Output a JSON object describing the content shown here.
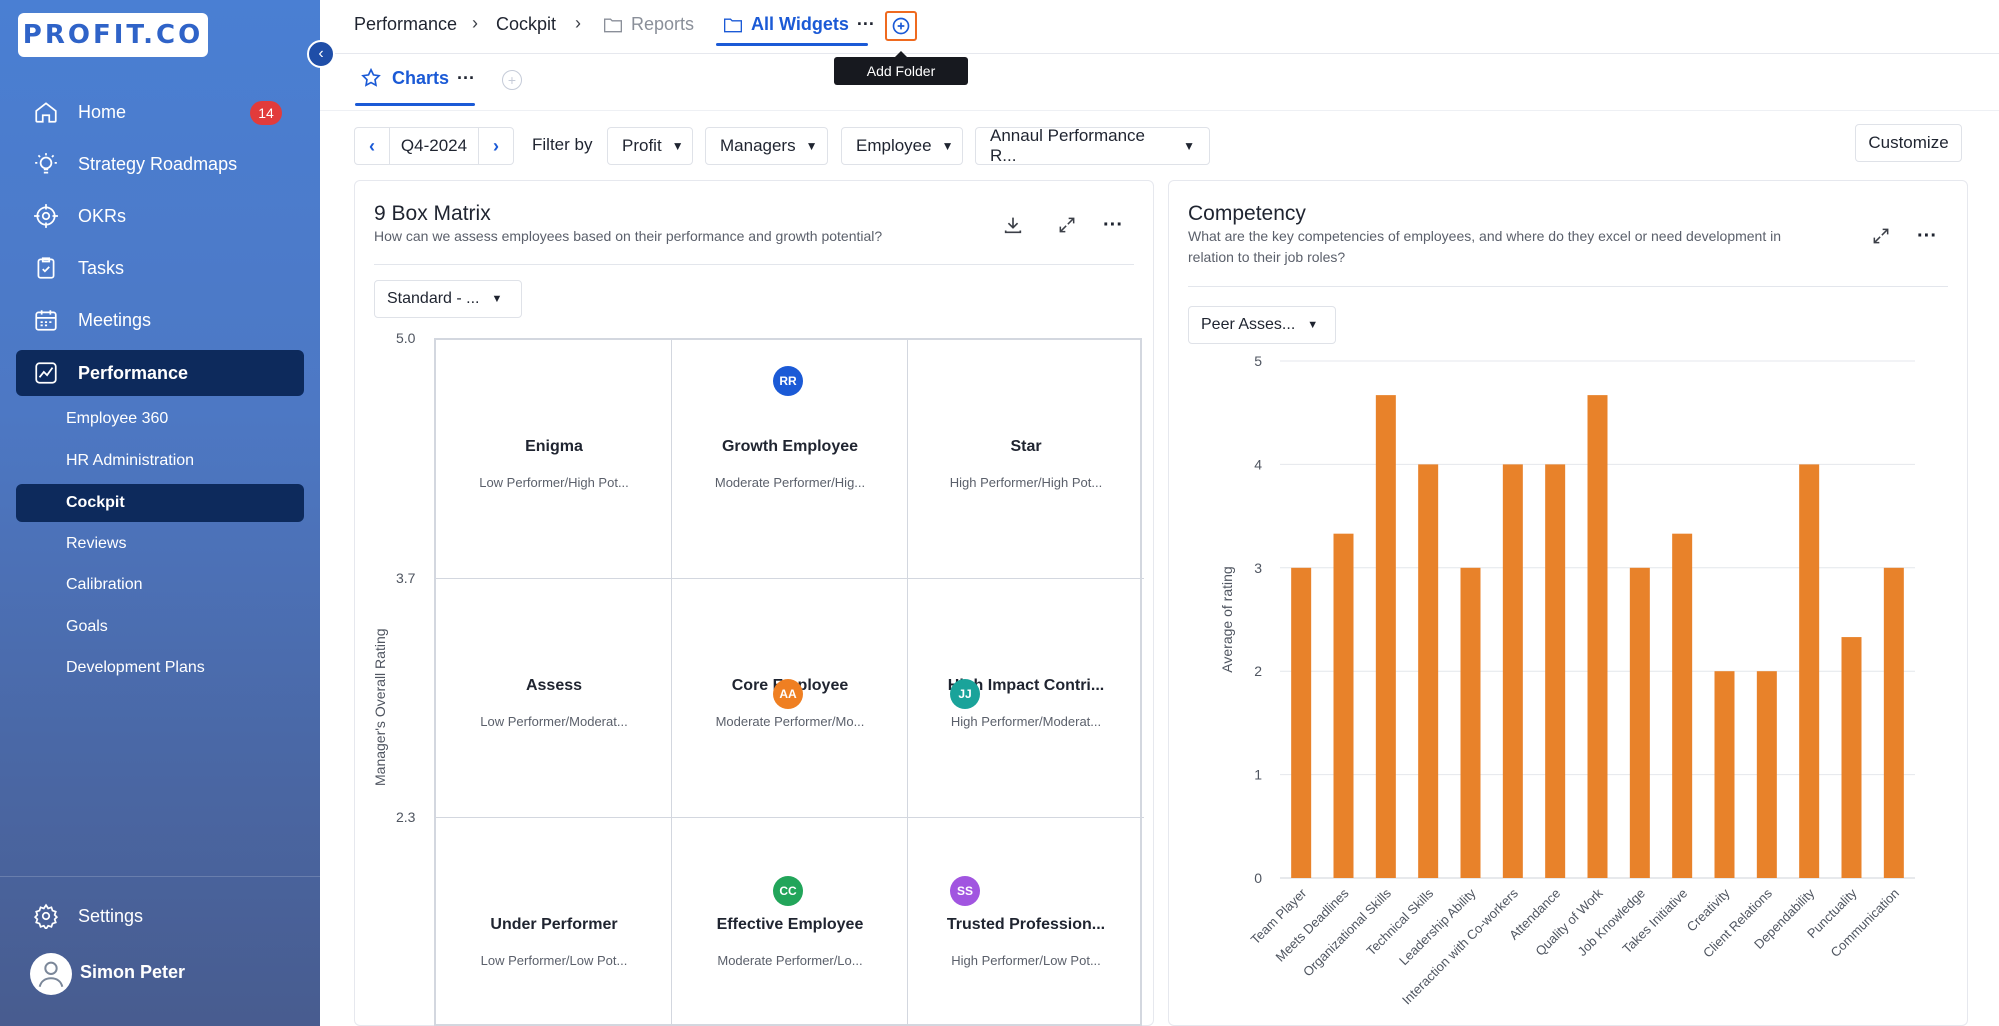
{
  "sidebar": {
    "logo": "PROFIT.CO",
    "items": [
      {
        "label": "Home",
        "badge": "14"
      },
      {
        "label": "Strategy Roadmaps"
      },
      {
        "label": "OKRs"
      },
      {
        "label": "Tasks"
      },
      {
        "label": "Meetings"
      },
      {
        "label": "Performance"
      }
    ],
    "sub_items": [
      "Employee 360",
      "HR Administration",
      "Cockpit",
      "Reviews",
      "Calibration",
      "Goals",
      "Development Plans"
    ],
    "settings": "Settings",
    "user": "Simon Peter"
  },
  "breadcrumb": {
    "items": [
      "Performance",
      "Cockpit",
      "Reports",
      "All Widgets"
    ],
    "tooltip": "Add Folder"
  },
  "tabs": {
    "charts": "Charts"
  },
  "filters": {
    "period": "Q4-2024",
    "filter_by": "Filter by",
    "profit": "Profit",
    "managers": "Managers",
    "employee": "Employee",
    "review": "Annaul Performance R...",
    "customize": "Customize"
  },
  "nine_box": {
    "title": "9 Box Matrix",
    "desc": "How can we assess employees based on their performance and growth potential?",
    "dropdown": "Standard - ...",
    "y_axis_title": "Manager's Overall Rating",
    "y_ticks": [
      "5.0",
      "3.7",
      "2.3"
    ],
    "cells": [
      {
        "title": "Enigma",
        "sub": "Low Performer/High Pot..."
      },
      {
        "title": "Growth Employee",
        "sub": "Moderate Performer/Hig..."
      },
      {
        "title": "Star",
        "sub": "High Performer/High Pot..."
      },
      {
        "title": "Assess",
        "sub": "Low Performer/Moderat..."
      },
      {
        "title": "Core Employee",
        "sub": "Moderate Performer/Mo..."
      },
      {
        "title": "High Impact Contri...",
        "sub": "High Performer/Moderat..."
      },
      {
        "title": "Under Performer",
        "sub": "Low Performer/Low Pot..."
      },
      {
        "title": "Effective Employee",
        "sub": "Moderate Performer/Lo..."
      },
      {
        "title": "Trusted Profession...",
        "sub": "High Performer/Low Pot..."
      }
    ],
    "chips": [
      {
        "initials": "RR",
        "color": "#1b5ad6"
      },
      {
        "initials": "AA",
        "color": "#ef7f22"
      },
      {
        "initials": "JJ",
        "color": "#1aa39a"
      },
      {
        "initials": "CC",
        "color": "#22a55a"
      },
      {
        "initials": "SS",
        "color": "#a155e0"
      }
    ]
  },
  "competency": {
    "title": "Competency",
    "desc_line1": "What are the key competencies of employees, and where do they excel or need development in",
    "desc_line2": "relation to their job roles?",
    "dropdown": "Peer Asses..."
  },
  "chart_data": {
    "type": "bar",
    "title": "",
    "ylabel": "Average of rating",
    "xlabel": "",
    "ylim": [
      0,
      5
    ],
    "yticks": [
      0,
      1,
      2,
      3,
      4,
      5
    ],
    "categories": [
      "Team Player",
      "Meets Deadlines",
      "Organizational Skills",
      "Technical Skills",
      "Leadership Ability",
      "Interaction with Co-workers",
      "Attendance",
      "Quality of Work",
      "Job Knowledge",
      "Takes Initiative",
      "Creativity",
      "Client Relations",
      "Dependability",
      "Punctuality",
      "Communication"
    ],
    "values": [
      3,
      3.33,
      4.67,
      4,
      3,
      4,
      4,
      4.67,
      3,
      3.33,
      2,
      2,
      4,
      2.33,
      3
    ],
    "bar_color": "#e8822a",
    "grid": true
  }
}
